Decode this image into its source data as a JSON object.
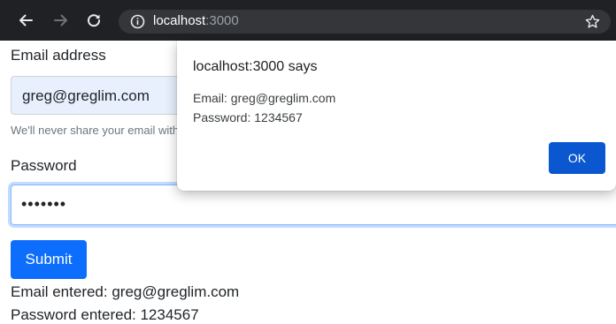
{
  "browser": {
    "url_host": "localhost",
    "url_port": ":3000",
    "icons": [
      "back-arrow-icon",
      "forward-arrow-icon",
      "reload-icon",
      "info-icon",
      "bookmark-star-icon"
    ],
    "toolbar_color": "#202124"
  },
  "form": {
    "email_label": "Email address",
    "email_value": "greg@greglim.com",
    "email_help": "We'll never share your email with anyone else.",
    "password_label": "Password",
    "password_value": "•••••••",
    "submit_label": "Submit",
    "accent_color": "#0d6efd"
  },
  "results": {
    "email_line": "Email entered: greg@greglim.com",
    "password_line": "Password entered: 1234567"
  },
  "dialog": {
    "title": "localhost:3000 says",
    "email_line": "Email: greg@greglim.com",
    "password_line": "Password: 1234567",
    "ok_label": "OK",
    "ok_color": "#0b57d0"
  }
}
